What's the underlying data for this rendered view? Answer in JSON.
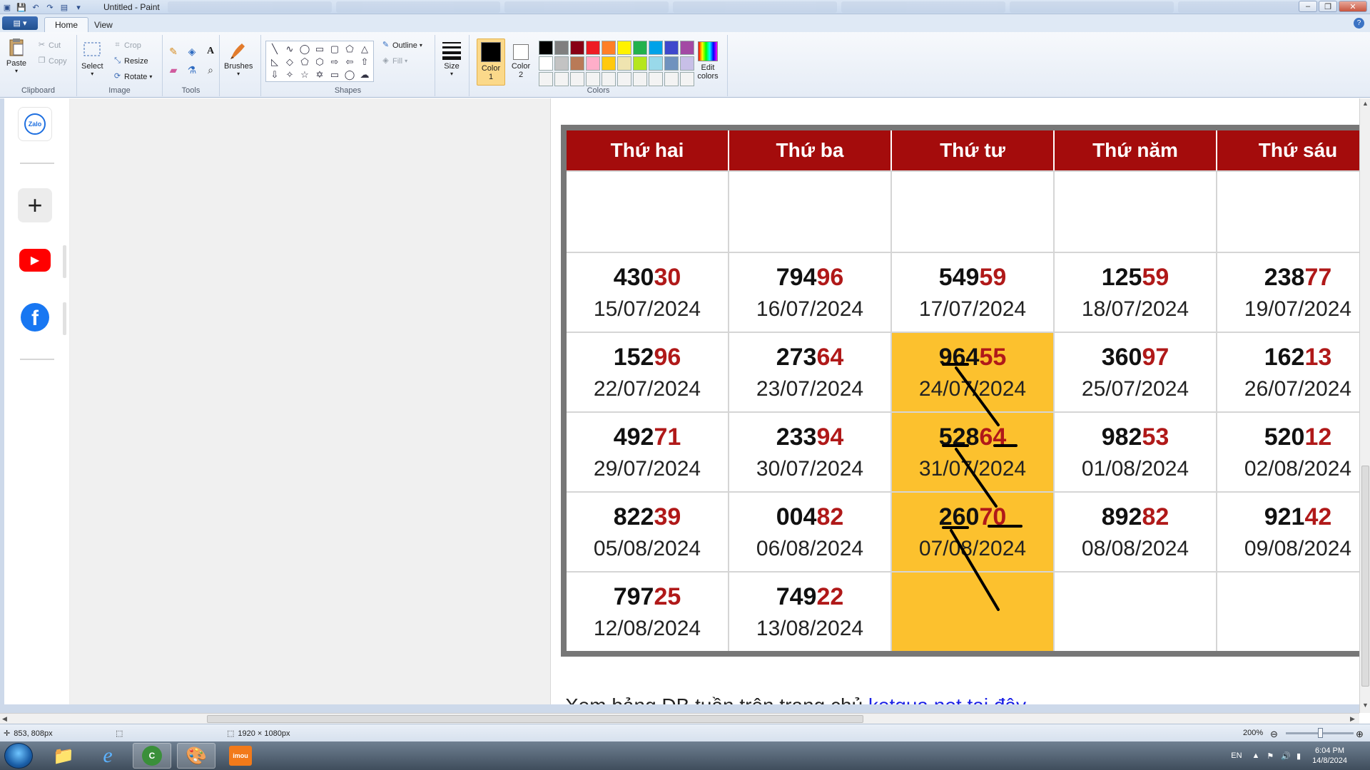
{
  "window": {
    "title": "Untitled - Paint"
  },
  "menu": {
    "tabs": [
      {
        "label": "Home"
      },
      {
        "label": "View"
      }
    ]
  },
  "ribbon": {
    "clipboard": {
      "paste": "Paste",
      "cut": "Cut",
      "copy": "Copy",
      "label": "Clipboard"
    },
    "image": {
      "select": "Select",
      "crop": "Crop",
      "resize": "Resize",
      "rotate": "Rotate",
      "label": "Image"
    },
    "tools": {
      "label": "Tools"
    },
    "brushes": {
      "label": "Brushes"
    },
    "shapes": {
      "outline": "Outline",
      "fill": "Fill",
      "label": "Shapes"
    },
    "size": {
      "label": "Size"
    },
    "colors": {
      "color1_line1": "Color",
      "color1_line2": "1",
      "color2_line1": "Color",
      "color2_line2": "2",
      "edit_line1": "Edit",
      "edit_line2": "colors",
      "label": "Colors",
      "color1_value": "#000000",
      "color2_value": "#ffffff",
      "palette": [
        "#000000",
        "#7f7f7f",
        "#880015",
        "#ed1c24",
        "#ff7f27",
        "#fff200",
        "#22b14c",
        "#00a2e8",
        "#3f48cc",
        "#a349a4",
        "#ffffff",
        "#c3c3c3",
        "#b97a57",
        "#ffaec9",
        "#ffc90e",
        "#efe4b0",
        "#b5e61d",
        "#99d9ea",
        "#7092be",
        "#c8bfe7",
        "#f3f3f3",
        "#f3f3f3",
        "#f3f3f3",
        "#f3f3f3",
        "#f3f3f3",
        "#f3f3f3",
        "#f3f3f3",
        "#f3f3f3",
        "#f3f3f3",
        "#f3f3f3"
      ]
    }
  },
  "sidebar": {
    "icons": [
      {
        "name": "zalo-icon",
        "text": "Zalo"
      },
      {
        "name": "add-icon",
        "text": "+"
      },
      {
        "name": "youtube-icon",
        "text": "▶"
      },
      {
        "name": "facebook-icon",
        "text": "f"
      }
    ]
  },
  "table": {
    "headers": [
      "Thứ hai",
      "Thứ ba",
      "Thứ tư",
      "Thứ năm",
      "Thứ sáu"
    ],
    "rows": [
      [
        {
          "head": "430",
          "tail": "30",
          "date": "15/07/2024"
        },
        {
          "head": "794",
          "tail": "96",
          "date": "16/07/2024"
        },
        {
          "head": "549",
          "tail": "59",
          "date": "17/07/2024"
        },
        {
          "head": "125",
          "tail": "59",
          "date": "18/07/2024"
        },
        {
          "head": "238",
          "tail": "77",
          "date": "19/07/2024"
        }
      ],
      [
        {
          "head": "152",
          "tail": "96",
          "date": "22/07/2024"
        },
        {
          "head": "273",
          "tail": "64",
          "date": "23/07/2024"
        },
        {
          "head": "964",
          "tail": "55",
          "date": "24/07/2024",
          "highlight": true
        },
        {
          "head": "360",
          "tail": "97",
          "date": "25/07/2024"
        },
        {
          "head": "162",
          "tail": "13",
          "date": "26/07/2024"
        }
      ],
      [
        {
          "head": "492",
          "tail": "71",
          "date": "29/07/2024"
        },
        {
          "head": "233",
          "tail": "94",
          "date": "30/07/2024"
        },
        {
          "head": "528",
          "tail": "64",
          "date": "31/07/2024",
          "highlight": true
        },
        {
          "head": "982",
          "tail": "53",
          "date": "01/08/2024"
        },
        {
          "head": "520",
          "tail": "12",
          "date": "02/08/2024"
        }
      ],
      [
        {
          "head": "822",
          "tail": "39",
          "date": "05/08/2024"
        },
        {
          "head": "004",
          "tail": "82",
          "date": "06/08/2024"
        },
        {
          "head": "260",
          "tail": "70",
          "date": "07/08/2024",
          "highlight": true
        },
        {
          "head": "892",
          "tail": "82",
          "date": "08/08/2024"
        },
        {
          "head": "921",
          "tail": "42",
          "date": "09/08/2024"
        }
      ],
      [
        {
          "head": "797",
          "tail": "25",
          "date": "12/08/2024"
        },
        {
          "head": "749",
          "tail": "22",
          "date": "13/08/2024"
        },
        {
          "head": "",
          "tail": "",
          "date": "",
          "highlight": true
        },
        {
          "head": "",
          "tail": "",
          "date": ""
        },
        {
          "head": "",
          "tail": "",
          "date": ""
        }
      ]
    ],
    "highlight_color": "#fcc12e",
    "header_color": "#a40c0c"
  },
  "footer": {
    "text": "Xem bảng ĐB tuần trên trang chủ ",
    "link": "ketqua.net tại đây"
  },
  "status": {
    "cursor": "853, 808px",
    "size": "1920 × 1080px",
    "zoom": "200%"
  },
  "taskbar": {
    "lang": "EN",
    "time": "6:04 PM",
    "date": "14/8/2024",
    "apps": [
      {
        "name": "explorer-app",
        "text": "📁"
      },
      {
        "name": "ie-app",
        "text": "e"
      },
      {
        "name": "coccoc-app",
        "text": "C"
      },
      {
        "name": "paint-app",
        "text": "🎨"
      },
      {
        "name": "imou-app",
        "text": "imou"
      }
    ]
  }
}
